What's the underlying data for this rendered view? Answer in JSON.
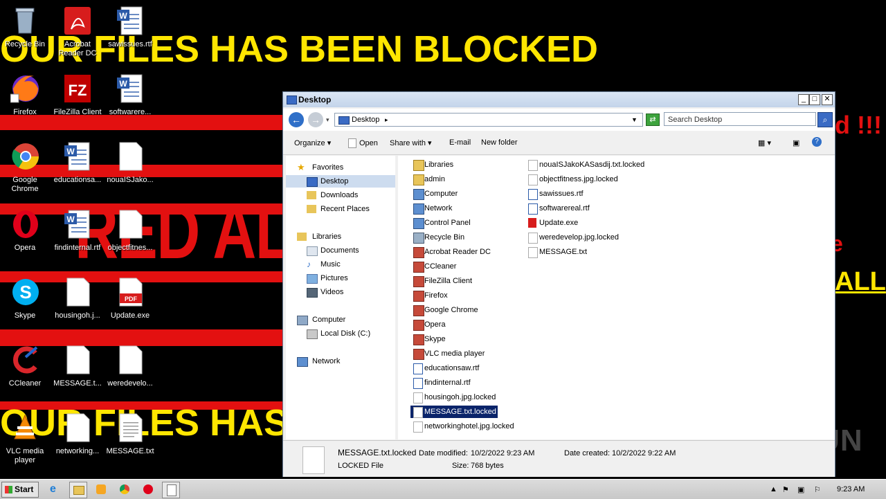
{
  "desktop": {
    "banner_top": "OUR FILES HAS BEEN BLOCKED",
    "banner_bottom": "OUR FILES HAS",
    "red_alert": "RED ALER",
    "right_red": "d !!!",
    "right_red2": "e",
    "right_yellow": "ALL",
    "icons": [
      {
        "label": "Recycle Bin",
        "icon": "recycle-bin-icon"
      },
      {
        "label": "Acrobat Reader DC",
        "icon": "acrobat-icon"
      },
      {
        "label": "sawissues.rtf",
        "icon": "word-doc-icon"
      },
      {
        "label": "Firefox",
        "icon": "firefox-icon"
      },
      {
        "label": "FileZilla Client",
        "icon": "filezilla-icon"
      },
      {
        "label": "softwarere...",
        "icon": "word-doc-icon"
      },
      {
        "label": "Google Chrome",
        "icon": "chrome-icon"
      },
      {
        "label": "educationsa...",
        "icon": "word-doc-icon"
      },
      {
        "label": "nouaISJako...",
        "icon": "blank-file-icon"
      },
      {
        "label": "Opera",
        "icon": "opera-icon"
      },
      {
        "label": "findinternal.rtf",
        "icon": "word-doc-icon"
      },
      {
        "label": "objectfitnes...",
        "icon": "blank-file-icon"
      },
      {
        "label": "Skype",
        "icon": "skype-icon"
      },
      {
        "label": "housingoh.j...",
        "icon": "blank-file-icon"
      },
      {
        "label": "Update.exe",
        "icon": "pdf-icon"
      },
      {
        "label": "CCleaner",
        "icon": "ccleaner-icon"
      },
      {
        "label": "MESSAGE.t...",
        "icon": "blank-file-icon"
      },
      {
        "label": "weredevelo...",
        "icon": "blank-file-icon"
      },
      {
        "label": "VLC media player",
        "icon": "vlc-icon"
      },
      {
        "label": "networking...",
        "icon": "blank-file-icon"
      },
      {
        "label": "MESSAGE.txt",
        "icon": "text-file-icon"
      }
    ]
  },
  "window": {
    "title": "Desktop",
    "address": "Desktop",
    "search_placeholder": "Search Desktop",
    "toolbar": {
      "organize": "Organize",
      "open": "Open",
      "share_with": "Share with",
      "email": "E-mail",
      "new_folder": "New folder"
    },
    "nav": {
      "favorites": "Favorites",
      "desktop": "Desktop",
      "downloads": "Downloads",
      "recent_places": "Recent Places",
      "libraries": "Libraries",
      "documents": "Documents",
      "music": "Music",
      "pictures": "Pictures",
      "videos": "Videos",
      "computer": "Computer",
      "local_disk": "Local Disk (C:)",
      "network": "Network"
    },
    "files_col1": [
      "Libraries",
      "admin",
      "Computer",
      "Network",
      "Control Panel",
      "Recycle Bin",
      "Acrobat Reader DC",
      "CCleaner",
      "FileZilla Client",
      "Firefox",
      "Google Chrome",
      "Opera",
      "Skype",
      "VLC media player",
      "educationsaw.rtf",
      "findinternal.rtf",
      "housingoh.jpg.locked",
      "MESSAGE.txt.locked",
      "networkinghotel.jpg.locked"
    ],
    "files_col2": [
      "nouaISJakoKASasdij.txt.locked",
      "objectfitness.jpg.locked",
      "sawissues.rtf",
      "softwarereal.rtf",
      "Update.exe",
      "weredevelop.jpg.locked",
      "MESSAGE.txt"
    ],
    "details": {
      "name": "MESSAGE.txt.locked",
      "type": "LOCKED File",
      "modified_label": "Date modified:",
      "modified": "10/2/2022 9:23 AM",
      "created_label": "Date created:",
      "created": "10/2/2022 9:22 AM",
      "size_label": "Size:",
      "size": "768 bytes"
    }
  },
  "taskbar": {
    "start": "Start",
    "clock": "9:23 AM"
  },
  "watermark": "ANY RUN"
}
